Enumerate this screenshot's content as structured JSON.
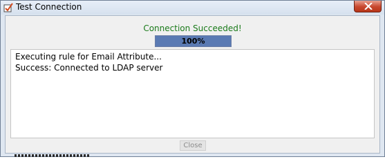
{
  "window": {
    "title": "Test Connection",
    "title_icon": "checkbox-check-icon",
    "close_icon": "close-x-icon"
  },
  "status": {
    "message": "Connection Succeeded!",
    "color": "#1a7a1a"
  },
  "progress": {
    "label": "100%",
    "value": 1.0,
    "fill_color": "#5a7ab3"
  },
  "log": {
    "lines": [
      "Executing rule for Email Attribute...",
      "Success: Connected to LDAP server"
    ]
  },
  "buttons": {
    "close_label": "Close"
  }
}
